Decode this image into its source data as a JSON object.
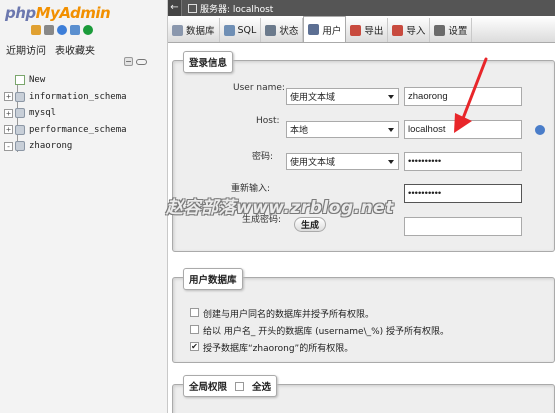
{
  "logo": {
    "part1": "php",
    "part2": "MyAdmin"
  },
  "nav": {
    "tabs": [
      "近期访问",
      "表收藏夹"
    ],
    "tree": [
      {
        "label": "New",
        "icon": "new-db-icon",
        "expander": ""
      },
      {
        "label": "information_schema",
        "icon": "database-icon",
        "expander": "+"
      },
      {
        "label": "mysql",
        "icon": "database-icon",
        "expander": "+"
      },
      {
        "label": "performance_schema",
        "icon": "database-icon",
        "expander": "+"
      },
      {
        "label": "zhaorong",
        "icon": "database-icon",
        "expander": "-"
      }
    ]
  },
  "topbar": {
    "back": "←",
    "title": "服务器: localhost"
  },
  "tabs": [
    {
      "label": "数据库",
      "icon": "database-icon",
      "color": "#8a97ad"
    },
    {
      "label": "SQL",
      "icon": "sql-icon",
      "color": "#6f8fb5"
    },
    {
      "label": "状态",
      "icon": "status-icon",
      "color": "#6b7a8c"
    },
    {
      "label": "用户",
      "icon": "users-icon",
      "color": "#5c6f93"
    },
    {
      "label": "导出",
      "icon": "export-icon",
      "color": "#c84a3e"
    },
    {
      "label": "导入",
      "icon": "import-icon",
      "color": "#c84a3e"
    },
    {
      "label": "设置",
      "icon": "wrench-icon",
      "color": "#6b6b6b"
    }
  ],
  "login": {
    "legend": "登录信息",
    "user_label": "User name:",
    "user_select": "使用文本域",
    "user_value": "zhaorong",
    "host_label": "Host:",
    "host_select": "本地",
    "host_value": "localhost",
    "password_label": "密码:",
    "password_select": "使用文本域",
    "password_value": "••••••••••",
    "retype_label": "重新输入:",
    "retype_value": "••••••••••",
    "gen_label": "生成密码:",
    "gen_button": "生成",
    "gen_value": ""
  },
  "userdb": {
    "legend": "用户数据库",
    "options": [
      {
        "label": "创建与用户同名的数据库并授予所有权限。",
        "checked": false
      },
      {
        "label": "给以 用户名_ 开头的数据库 (username\\_%) 授予所有权限。",
        "checked": false
      },
      {
        "label": "授予数据库“zhaorong”的所有权限。",
        "checked": true
      }
    ]
  },
  "global": {
    "legend": "全局权限",
    "select_all": "全选"
  },
  "watermark": "赵容部落www.zrblog.net",
  "colors": {
    "accent_arrow": "#e8262a",
    "topbar": "#555555"
  }
}
